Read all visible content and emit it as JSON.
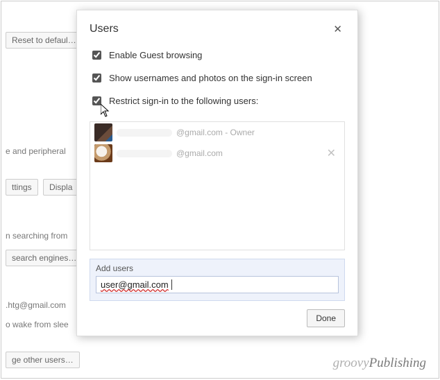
{
  "background": {
    "reset_btn": "Reset to defaul…",
    "peripherals": "e and peripheral",
    "settings_btn": "ttings",
    "display_btn": "Displa",
    "searching": "n searching from",
    "search_engines_btn": "search engines…",
    "email": ".htg@gmail.com",
    "wake": "o wake from slee",
    "manage_users_btn": "ge other users…"
  },
  "modal": {
    "title": "Users",
    "close_glyph": "✕",
    "options": {
      "guest": {
        "label": "Enable Guest browsing",
        "checked": true
      },
      "show_usernames": {
        "label": "Show usernames and photos on the sign-in screen",
        "checked": true
      },
      "restrict": {
        "label": "Restrict sign-in to the following users:",
        "checked": true
      }
    },
    "users": [
      {
        "domain": "@gmail.com",
        "suffix": " - Owner",
        "removable": false
      },
      {
        "domain": "@gmail.com",
        "suffix": "",
        "removable": true
      }
    ],
    "add": {
      "label": "Add users",
      "value": "user@gmail.com"
    },
    "done_label": "Done"
  },
  "watermark": {
    "text1": "groovy",
    "text2": "Publishing"
  }
}
